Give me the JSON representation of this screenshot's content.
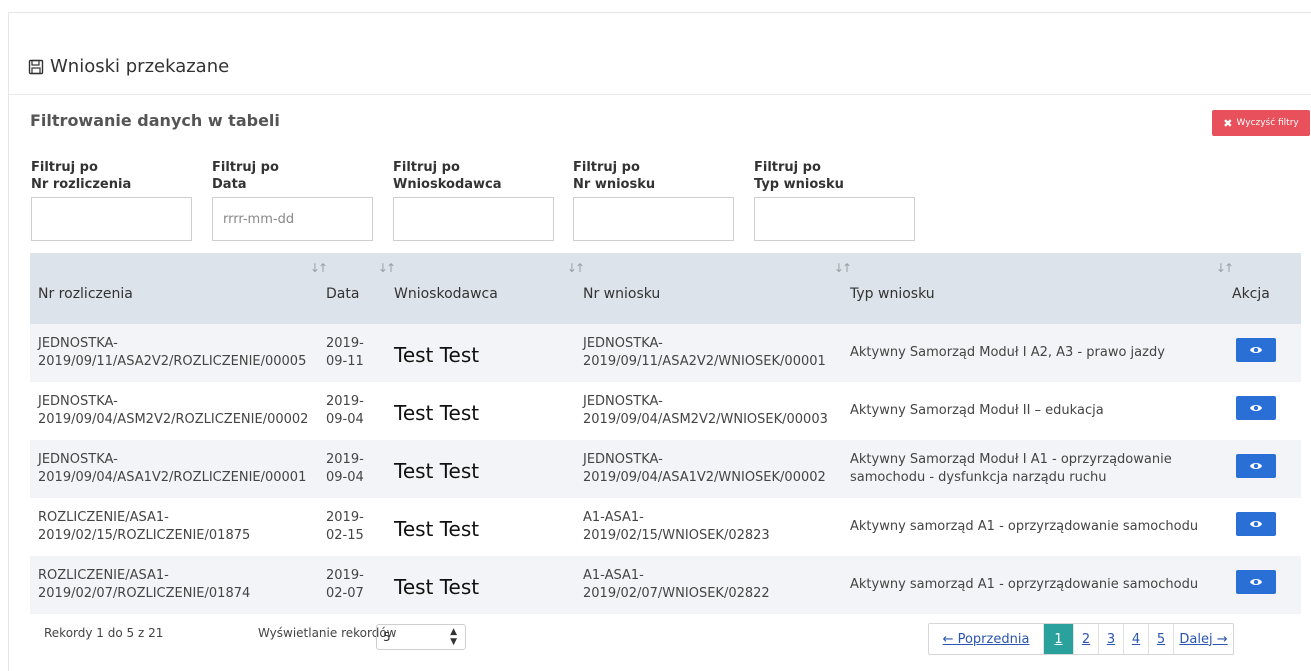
{
  "header": {
    "title": "Wnioski przekazane",
    "icon": "save-icon"
  },
  "filters": {
    "heading": "Filtrowanie danych w tabeli",
    "clear_label": "Wyczyść filtry",
    "clear_color": "#e8505b",
    "items": [
      {
        "line1": "Filtruj po",
        "line2": "Nr rozliczenia",
        "placeholder": ""
      },
      {
        "line1": "Filtruj po",
        "line2": "Data",
        "placeholder": "rrrr-mm-dd"
      },
      {
        "line1": "Filtruj po",
        "line2": "Wnioskodawca",
        "placeholder": ""
      },
      {
        "line1": "Filtruj po",
        "line2": "Nr wniosku",
        "placeholder": ""
      },
      {
        "line1": "Filtruj po",
        "line2": "Typ wniosku",
        "placeholder": ""
      }
    ]
  },
  "table": {
    "columns": [
      "Nr rozliczenia",
      "Data",
      "Wnioskodawca",
      "Nr wniosku",
      "Typ wniosku",
      "Akcja"
    ],
    "rows": [
      {
        "nr_rozliczenia": [
          "JEDNOSTKA-",
          "2019/09/11/ASA2V2/ROZLICZENIE/00005"
        ],
        "data": [
          "2019-",
          "09-11"
        ],
        "wnioskodawca": "Test Test",
        "nr_wniosku": [
          "JEDNOSTKA-",
          "2019/09/11/ASA2V2/WNIOSEK/00001"
        ],
        "typ": [
          "Aktywny Samorząd Moduł I A2, A3 - prawo jazdy",
          ""
        ]
      },
      {
        "nr_rozliczenia": [
          "JEDNOSTKA-",
          "2019/09/04/ASM2V2/ROZLICZENIE/00002"
        ],
        "data": [
          "2019-",
          "09-04"
        ],
        "wnioskodawca": "Test Test",
        "nr_wniosku": [
          "JEDNOSTKA-",
          "2019/09/04/ASM2V2/WNIOSEK/00003"
        ],
        "typ": [
          "Aktywny Samorząd Moduł II – edukacja",
          ""
        ]
      },
      {
        "nr_rozliczenia": [
          "JEDNOSTKA-",
          "2019/09/04/ASA1V2/ROZLICZENIE/00001"
        ],
        "data": [
          "2019-",
          "09-04"
        ],
        "wnioskodawca": "Test Test",
        "nr_wniosku": [
          "JEDNOSTKA-",
          "2019/09/04/ASA1V2/WNIOSEK/00002"
        ],
        "typ": [
          "Aktywny Samorząd Moduł I A1 - oprzyrządowanie",
          "samochodu - dysfunkcja narządu ruchu"
        ]
      },
      {
        "nr_rozliczenia": [
          "ROZLICZENIE/ASA1-",
          "2019/02/15/ROZLICZENIE/01875"
        ],
        "data": [
          "2019-",
          "02-15"
        ],
        "wnioskodawca": "Test Test",
        "nr_wniosku": [
          "A1-ASA1-",
          "2019/02/15/WNIOSEK/02823"
        ],
        "typ": [
          "Aktywny samorząd A1 - oprzyrządowanie samochodu",
          ""
        ]
      },
      {
        "nr_rozliczenia": [
          "ROZLICZENIE/ASA1-",
          "2019/02/07/ROZLICZENIE/01874"
        ],
        "data": [
          "2019-",
          "02-07"
        ],
        "wnioskodawca": "Test Test",
        "nr_wniosku": [
          "A1-ASA1-",
          "2019/02/07/WNIOSEK/02822"
        ],
        "typ": [
          "Aktywny samorząd A1 - oprzyrządowanie samochodu",
          ""
        ]
      }
    ],
    "action_icon": "eye-icon",
    "action_color": "#2a6fd6"
  },
  "footer": {
    "info": "Rekordy 1 do 5 z 21",
    "length_label": "Wyświetlanie rekordów",
    "length_value": "5",
    "pagination": {
      "prev": "← Poprzednia",
      "pages": [
        "1",
        "2",
        "3",
        "4",
        "5"
      ],
      "active": "1",
      "next": "Dalej →",
      "active_color": "#2aa19c"
    }
  }
}
